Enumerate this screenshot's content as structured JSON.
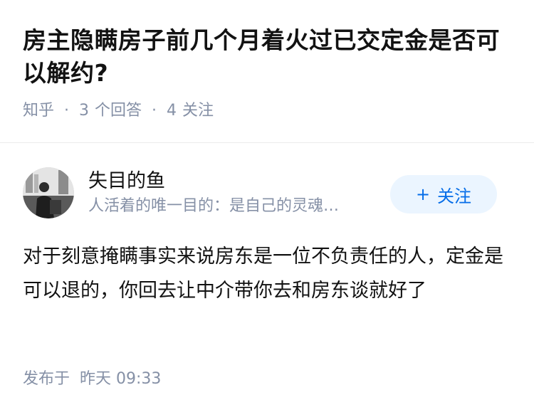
{
  "question": {
    "title": "房主隐瞒房子前几个月着火过已交定金是否可以解约?",
    "source": "知乎",
    "answer_count": "3",
    "answer_label": "个回答",
    "follow_count": "4",
    "follow_label": "关注"
  },
  "author": {
    "name": "失目的鱼",
    "bio": "人活着的唯一目的：是自己的灵魂…",
    "follow_button": "关注"
  },
  "answer": {
    "text": "对于刻意掩瞒事实来说房东是一位不负责任的人，定金是可以退的，你回去让中介带你去和房东谈就好了",
    "published_prefix": "发布于",
    "published_time": "昨天 09:33"
  },
  "colors": {
    "meta_gray": "#8590a6",
    "brand_blue": "#056de8",
    "follow_bg": "#ebf5ff"
  }
}
